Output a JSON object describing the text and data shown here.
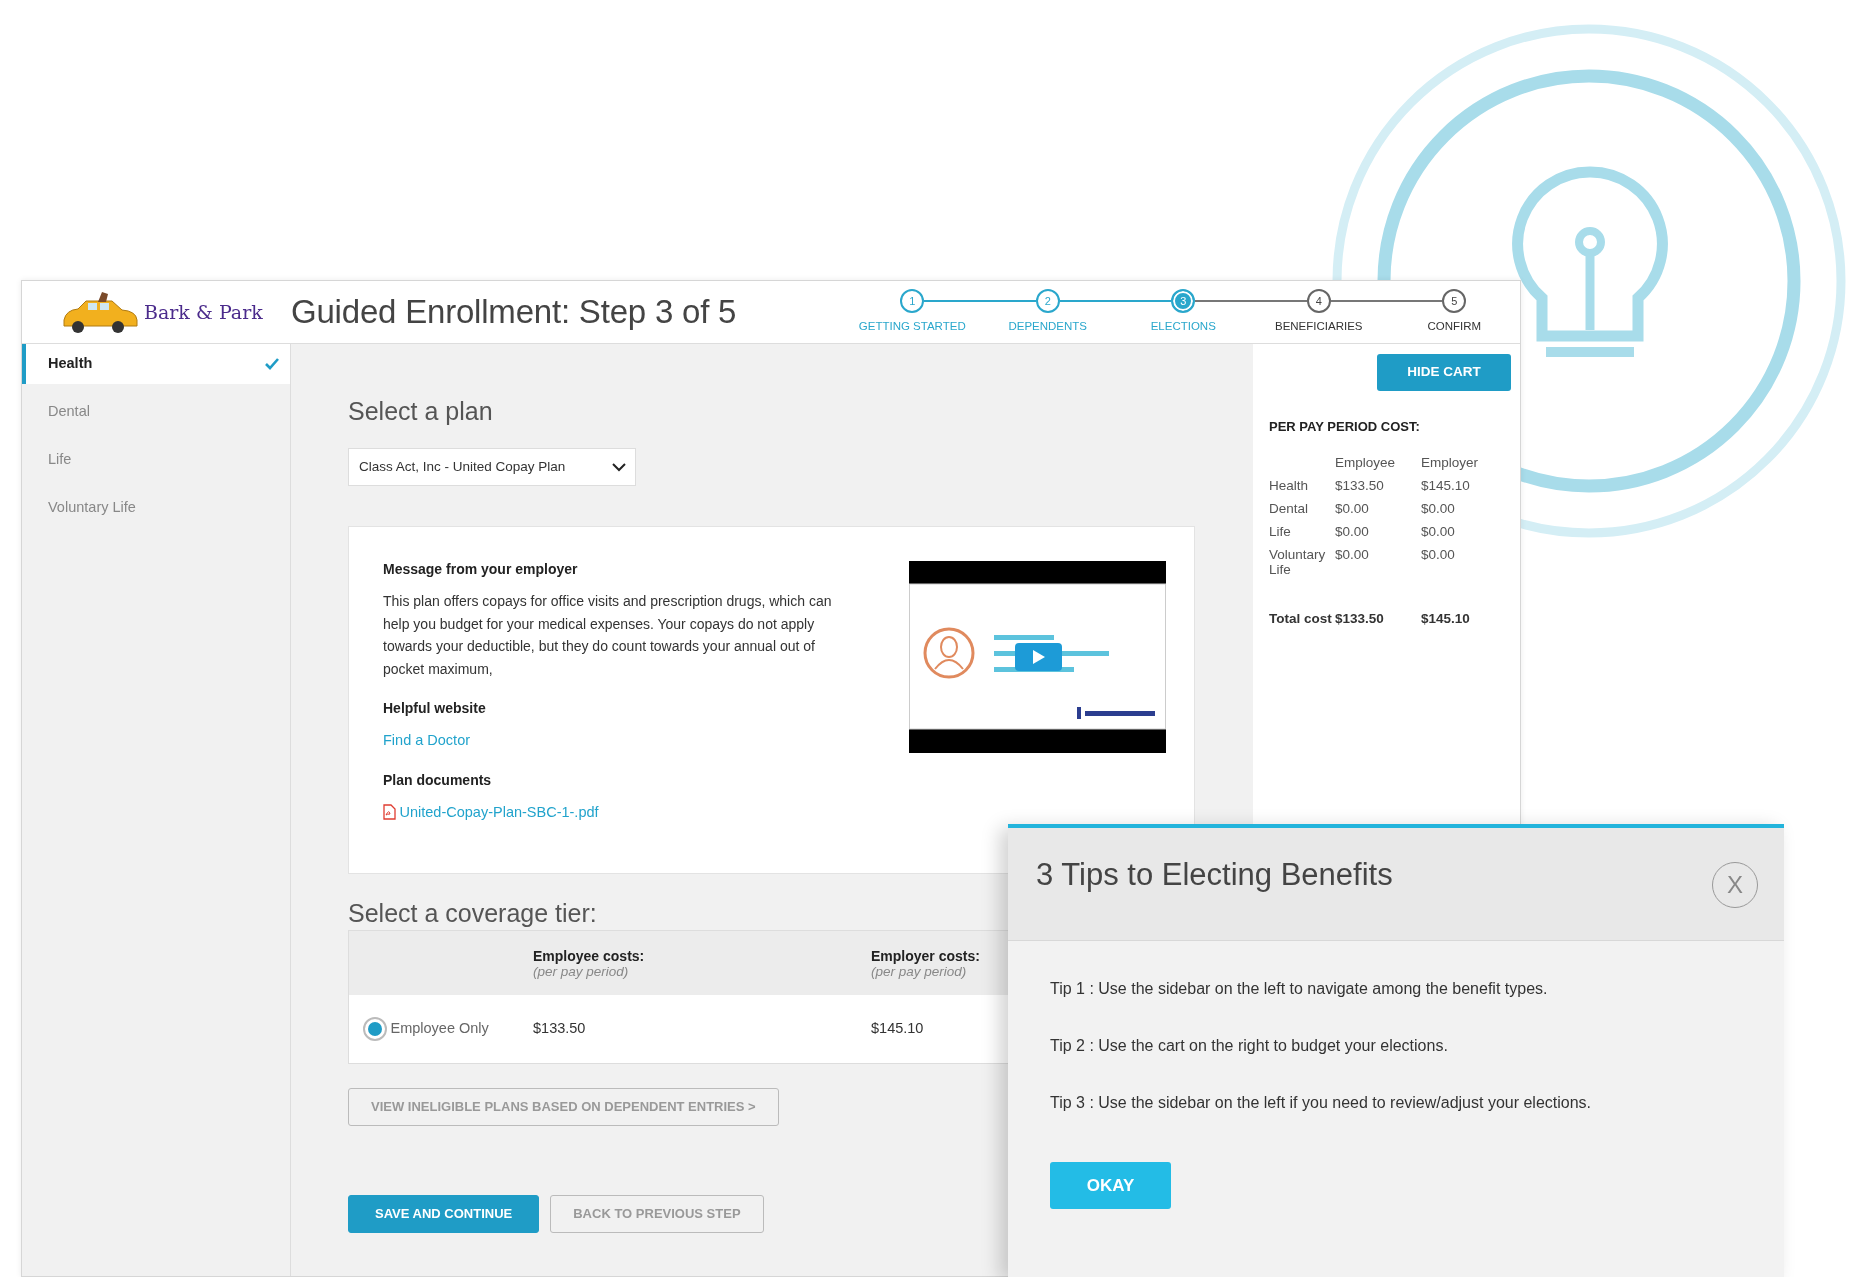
{
  "brand": {
    "name": "Bark & Park"
  },
  "header": {
    "title": "Guided Enrollment: Step 3 of 5"
  },
  "steps": [
    {
      "number": "1",
      "label": "GETTING STARTED",
      "completed": true,
      "selected": false
    },
    {
      "number": "2",
      "label": "DEPENDENTS",
      "completed": true,
      "selected": false
    },
    {
      "number": "3",
      "label": "ELECTIONS",
      "completed": false,
      "selected": true
    },
    {
      "number": "4",
      "label": "BENEFICIARIES",
      "completed": false,
      "selected": false
    },
    {
      "number": "5",
      "label": "CONFIRM",
      "completed": false,
      "selected": false
    }
  ],
  "sidebar": {
    "items": [
      {
        "label": "Health",
        "selected": true,
        "checked": true
      },
      {
        "label": "Dental",
        "selected": false,
        "checked": false
      },
      {
        "label": "Life",
        "selected": false,
        "checked": false
      },
      {
        "label": "Voluntary Life",
        "selected": false,
        "checked": false
      }
    ]
  },
  "plan": {
    "heading": "Select a plan",
    "dropdown": {
      "value": "Class Act, Inc - United Copay Plan"
    }
  },
  "message_card": {
    "message_heading": "Message from your employer",
    "message": "This plan offers copays for office visits and prescription drugs, which can help you budget for your medical expenses. Your copays do not apply towards your deductible, but they do count towards your annual out of pocket maximum,",
    "website_heading": "Helpful website",
    "website_link": "Find a Doctor",
    "documents_heading": "Plan documents",
    "document_link": "United-Copay-Plan-SBC-1-.pdf"
  },
  "coverage": {
    "heading": "Select a coverage tier:",
    "columns": [
      {
        "title": "Employee costs:",
        "subtitle": "(per pay period)"
      },
      {
        "title": "Employer costs:",
        "subtitle": "(per pay period)"
      }
    ],
    "rows": [
      {
        "label": "Employee Only",
        "selected": true,
        "employee": "$133.50",
        "employer": "$145.10"
      }
    ]
  },
  "ineligible_button": "VIEW INELIGIBLE PLANS BASED ON DEPENDENT ENTRIES >",
  "actions": [
    {
      "label": "SAVE AND CONTINUE",
      "kind": "primary"
    },
    {
      "label": "BACK TO PREVIOUS STEP",
      "kind": "secondary"
    }
  ],
  "cart": {
    "button": "HIDE CART",
    "heading": "PER PAY PERIOD COST:",
    "columns": [
      "Employee",
      "Employer"
    ],
    "rows": [
      {
        "label": "Health",
        "employee": "$133.50",
        "employer": "$145.10"
      },
      {
        "label": "Dental",
        "employee": "$0.00",
        "employer": "$0.00"
      },
      {
        "label": "Life",
        "employee": "$0.00",
        "employer": "$0.00"
      },
      {
        "label": "Voluntary Life",
        "employee": "$0.00",
        "employer": "$0.00"
      }
    ],
    "total": {
      "label": "Total cost",
      "employee": "$133.50",
      "employer": "$145.10"
    }
  },
  "modal": {
    "title": "3 Tips to Electing Benefits",
    "close": "X",
    "tips": [
      "Tip 1 : Use the sidebar on the left to navigate among the benefit types.",
      "Tip 2 : Use the cart on the right to budget your elections.",
      "Tip 3 : Use the sidebar on the left if you need to review/adjust your elections."
    ],
    "button": "OKAY"
  }
}
